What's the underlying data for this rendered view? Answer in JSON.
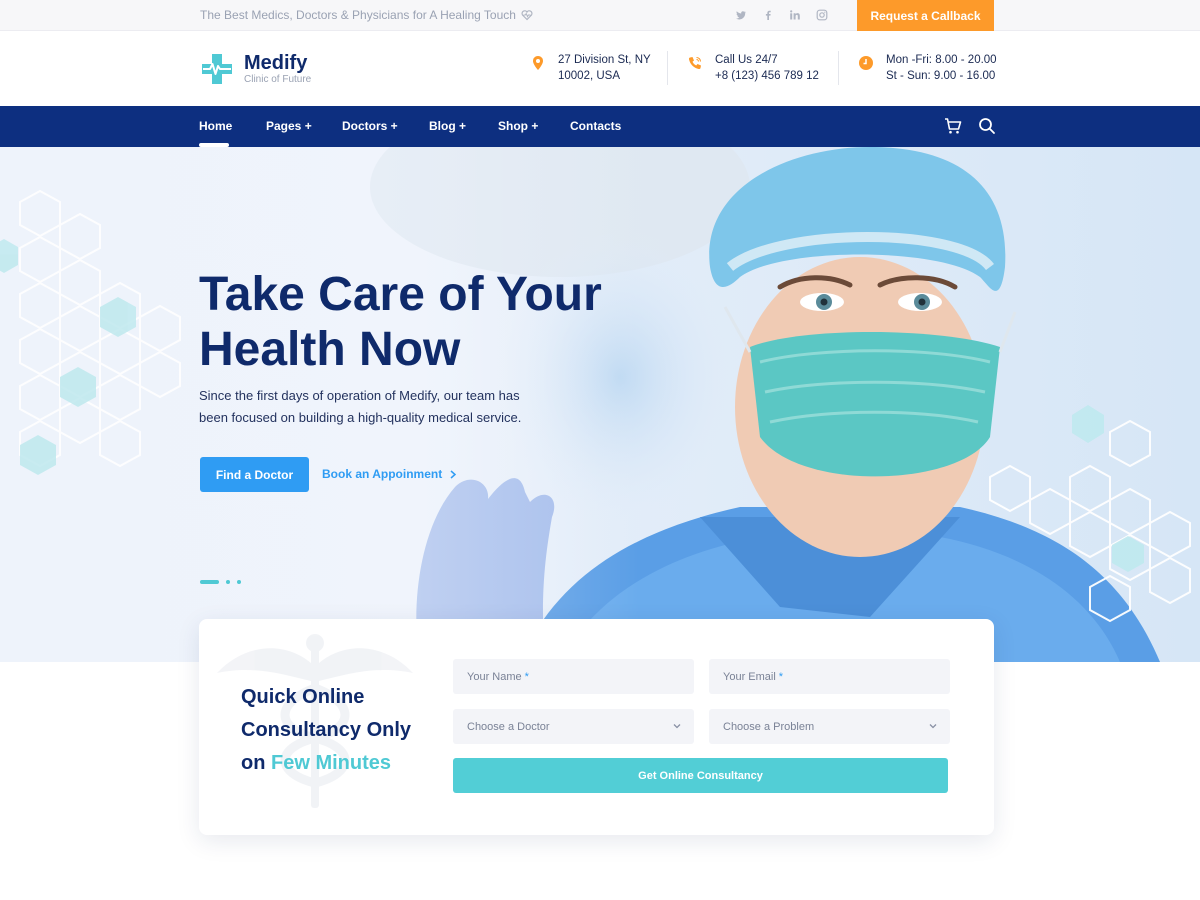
{
  "topbar": {
    "tagline": "The Best Medics, Doctors & Physicians for A Healing Touch",
    "socials": [
      "twitter-icon",
      "facebook-icon",
      "linkedin-icon",
      "instagram-icon"
    ],
    "callback_label": "Request a Callback"
  },
  "header": {
    "brand": "Medify",
    "brand_sub": "Clinic of Future",
    "address_line1": "27 Division St, NY",
    "address_line2": "10002, USA",
    "phone_line1": "Call Us 24/7",
    "phone_line2": "+8 (123) 456 789 12",
    "hours_line1": "Mon -Fri: 8.00 - 20.00",
    "hours_line2": "St - Sun: 9.00 - 16.00"
  },
  "nav": {
    "items": [
      "Home",
      "Pages +",
      "Doctors +",
      "Blog +",
      "Shop +",
      "Contacts"
    ],
    "active": "Home"
  },
  "hero": {
    "title_line1": "Take Care of Your",
    "title_line2": "Health Now",
    "description": "Since the first days of operation of Medify, our team has been focused on building a high-quality medical service.",
    "primary_button": "Find a Doctor",
    "secondary_link": "Book an Appoinment",
    "slider_dots": 3,
    "active_dot": 1
  },
  "consult": {
    "title_line1": "Quick Online",
    "title_line2": "Consultancy Only",
    "title_on": "on",
    "title_accent": "Few Minutes",
    "name_placeholder": "Your Name",
    "email_placeholder": "Your Email",
    "required_mark": "*",
    "doctor_select": "Choose a Doctor",
    "problem_select": "Choose a Problem",
    "submit_label": "Get Online Consultancy"
  },
  "colors": {
    "navy": "#0d2f80",
    "orange": "#fd9a2a",
    "blue": "#2f9cf3",
    "teal": "#52ced6"
  }
}
